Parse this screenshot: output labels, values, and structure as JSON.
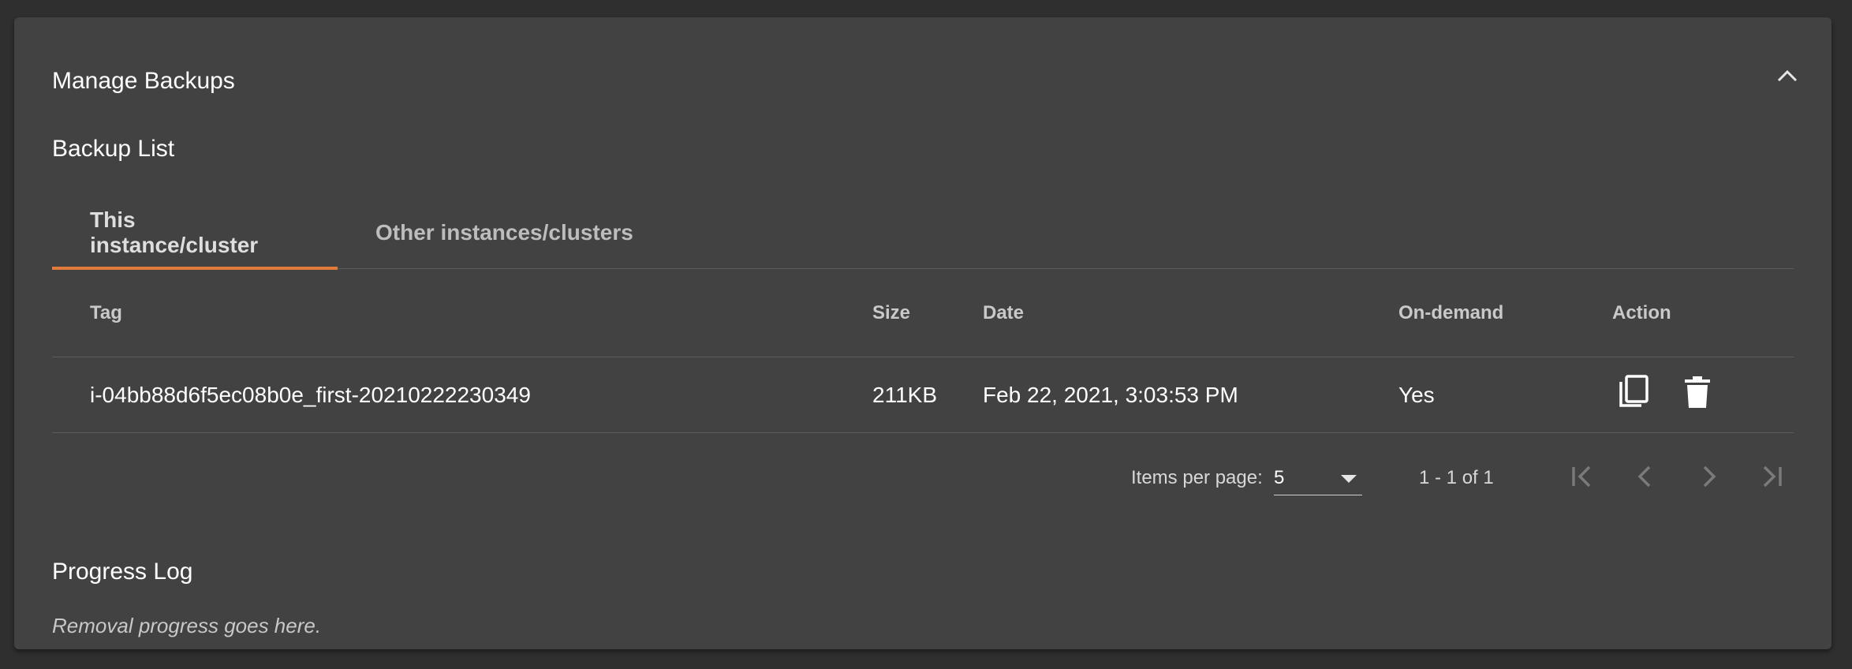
{
  "panel": {
    "title": "Manage Backups",
    "collapse_icon": "chevron-up-icon"
  },
  "backup_list": {
    "title": "Backup List",
    "tabs": [
      {
        "label": "This instance/cluster",
        "active": true
      },
      {
        "label": "Other instances/clusters",
        "active": false
      }
    ],
    "columns": [
      "Tag",
      "Size",
      "Date",
      "On-demand",
      "Action"
    ],
    "rows": [
      {
        "tag": "i-04bb88d6f5ec08b0e_first-20210222230349",
        "size": "211KB",
        "date": "Feb 22, 2021, 3:03:53 PM",
        "on_demand": "Yes",
        "actions": [
          "copy-icon",
          "delete-icon"
        ]
      }
    ]
  },
  "paginator": {
    "items_per_page_label": "Items per page:",
    "items_per_page_value": "5",
    "range_label": "1 - 1 of 1",
    "buttons": [
      "first-page-icon",
      "previous-page-icon",
      "next-page-icon",
      "last-page-icon"
    ]
  },
  "progress_log": {
    "title": "Progress Log",
    "text": "Removal progress goes here."
  },
  "colors": {
    "background": "#2f2f2f",
    "panel": "#424242",
    "tab_accent": "#e07b39"
  }
}
